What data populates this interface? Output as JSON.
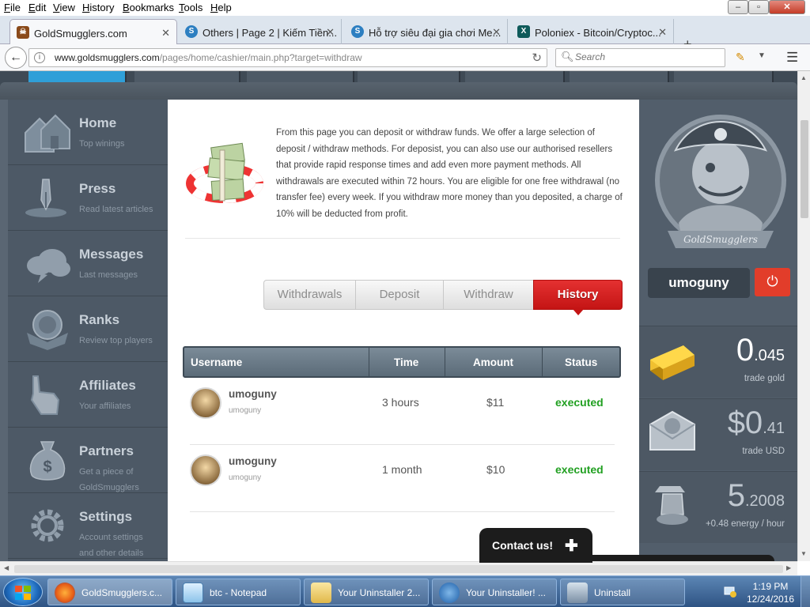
{
  "browser": {
    "menu": [
      "File",
      "Edit",
      "View",
      "History",
      "Bookmarks",
      "Tools",
      "Help"
    ],
    "window_controls": {
      "minimize": "–",
      "maximize": "▫",
      "close": "✕"
    },
    "tabs": [
      {
        "title": "GoldSmugglers.com",
        "active": true
      },
      {
        "title": "Others | Page 2 | Kiếm Tiền...",
        "active": false
      },
      {
        "title": "Hỗ trợ siêu đại gia chơi Me...",
        "active": false
      },
      {
        "title": "Poloniex - Bitcoin/Cryptoc...",
        "active": false
      }
    ],
    "tab_close": "✕",
    "new_tab": "+",
    "url_domain": "www.goldsmugglers.com",
    "url_path": "/pages/home/cashier/main.php?target=withdraw",
    "search_placeholder": "Search"
  },
  "sidebar": {
    "items": [
      {
        "title": "Home",
        "sub": "Top winings",
        "icon": "house-icon"
      },
      {
        "title": "Press",
        "sub": "Read latest articles",
        "icon": "fountain-pen-icon"
      },
      {
        "title": "Messages",
        "sub": "Last messages",
        "icon": "cloud-icon"
      },
      {
        "title": "Ranks",
        "sub": "Review top players",
        "icon": "rank-badge-icon"
      },
      {
        "title": "Affiliates",
        "sub": "Your affiliates",
        "icon": "pointer-hand-icon"
      },
      {
        "title": "Partners",
        "sub": "Get a piece of GoldSmugglers",
        "icon": "money-bag-icon"
      },
      {
        "title": "Settings",
        "sub": "Account settings and other details",
        "icon": "gear-icon"
      }
    ]
  },
  "main": {
    "intro_text": "From this page you can deposit or withdraw funds. We offer a large selection of deposit / withdraw methods. For deposist, you can also use our authorised resellers that provide rapid response times and add even more payment methods. All withdrawals are executed within 72 hours. You are eligible for one free withdrawal (no transfer fee) every week. If you withdraw more money than you deposited, a charge of 10% will be deducted from profit.",
    "tabs": [
      {
        "label": "Withdrawals",
        "active": false
      },
      {
        "label": "Deposit",
        "active": false
      },
      {
        "label": "Withdraw",
        "active": false
      },
      {
        "label": "History",
        "active": true
      }
    ],
    "table": {
      "headers": [
        "Username",
        "Time",
        "Amount",
        "Status"
      ],
      "rows": [
        {
          "username": "umoguny",
          "sub": "umoguny",
          "time": "3 hours",
          "amount": "$11",
          "status": "executed"
        },
        {
          "username": "umoguny",
          "sub": "umoguny",
          "time": "1 month",
          "amount": "$10",
          "status": "executed"
        }
      ]
    },
    "contact_label": "Contact us!",
    "contact_plus": "✚"
  },
  "right_panel": {
    "mascot_caption": "GoldSmugglers",
    "username": "umoguny",
    "logout_icon": "⏻",
    "stats": [
      {
        "whole": "0",
        "fraction": ".045",
        "label": "trade gold",
        "icon": "gold-bar-icon"
      },
      {
        "whole": "$0",
        "fraction": ".41",
        "label": "trade USD",
        "icon": "dollar-envelope-icon"
      },
      {
        "whole": "5",
        "fraction": ".2008",
        "label": "+0.48 energy / hour",
        "icon": "treasure-icon"
      }
    ]
  },
  "taskbar": {
    "tasks": [
      {
        "label": "GoldSmugglers.c...",
        "active": true,
        "icon": "firefox-icon"
      },
      {
        "label": "btc - Notepad",
        "active": false,
        "icon": "notepad-icon"
      },
      {
        "label": "Your Uninstaller 2...",
        "active": false,
        "icon": "folder-icon"
      },
      {
        "label": "Your Uninstaller! ...",
        "active": false,
        "icon": "uninstaller-icon"
      },
      {
        "label": "Uninstall",
        "active": false,
        "icon": "uninstall-icon"
      }
    ],
    "time": "1:19 PM",
    "date": "12/24/2016"
  },
  "colors": {
    "accent_red": "#d41e1e",
    "status_green": "#22a022",
    "sidebar_bg": "#4d5966",
    "topnav_active": "#2f9fd8"
  }
}
